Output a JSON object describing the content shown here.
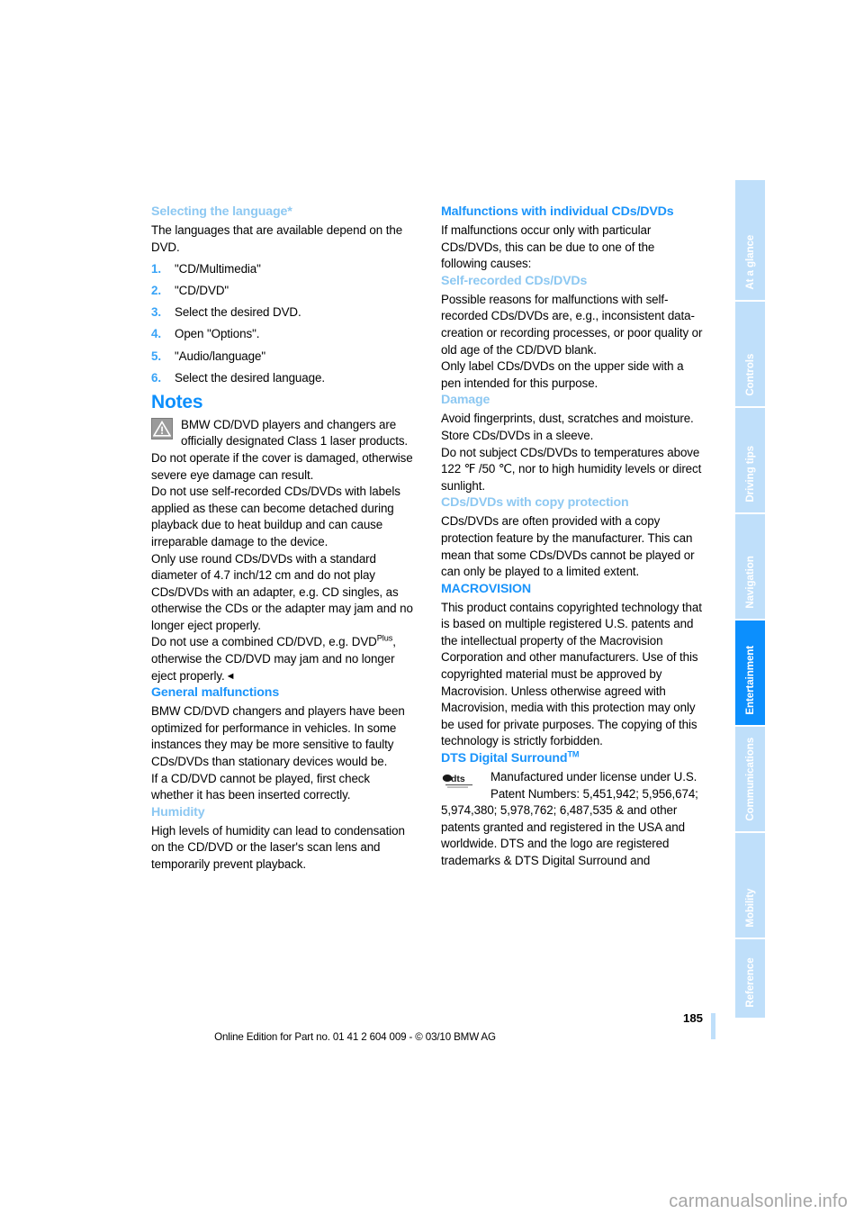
{
  "document": {
    "page_number": "185",
    "footer_text": "Online Edition for Part no. 01 41 2 604 009 - © 03/10 BMW AG",
    "watermark": "carmanualsonline.info",
    "accent_blue": "#0d8ffc",
    "light_blue": "#8dc8f2",
    "tab_blue": "#bfdffa"
  },
  "sidebar": {
    "tabs": [
      {
        "label": "At a glance",
        "active": false
      },
      {
        "label": "Controls",
        "active": false
      },
      {
        "label": "Driving tips",
        "active": false
      },
      {
        "label": "Navigation",
        "active": false
      },
      {
        "label": "Entertainment",
        "active": true
      },
      {
        "label": "Communications",
        "active": false
      },
      {
        "label": "Mobility",
        "active": false
      },
      {
        "label": "Reference",
        "active": false
      }
    ]
  },
  "left_column": {
    "selecting_language": {
      "heading": "Selecting the language*",
      "intro": "The languages that are available depend on the DVD.",
      "steps": [
        {
          "num": "1.",
          "text": "\"CD/Multimedia\""
        },
        {
          "num": "2.",
          "text": "\"CD/DVD\""
        },
        {
          "num": "3.",
          "text": "Select the desired DVD."
        },
        {
          "num": "4.",
          "text": "Open \"Options\"."
        },
        {
          "num": "5.",
          "text": "\"Audio/language\""
        },
        {
          "num": "6.",
          "text": "Select the desired language."
        }
      ]
    },
    "notes": {
      "heading": "Notes",
      "icon": "warning-triangle-icon",
      "para1": "BMW CD/DVD players and changers are officially designated Class 1 laser products. Do not operate if the cover is damaged, otherwise severe eye damage can result.",
      "para2": "Do not use self-recorded CDs/DVDs with labels applied as these can become detached during playback due to heat buildup and can cause irreparable damage to the device.",
      "para3": "Only use round CDs/DVDs with a standard diameter of 4.7 inch/12 cm and do not play CDs/DVDs with an adapter, e.g. CD singles, as otherwise the CDs or the adapter may jam and no longer eject properly.",
      "para4_pre": "Do not use a combined CD/DVD, e.g. DVD",
      "para4_sup": "Plus",
      "para4_post": ", otherwise the CD/DVD may jam and no longer eject properly.",
      "endmark": "◄"
    },
    "general_malfunctions": {
      "heading": "General malfunctions",
      "para1": "BMW CD/DVD changers and players have been optimized for performance in vehicles. In some instances they may be more sensitive to faulty CDs/DVDs than stationary devices would be.",
      "para2": "If a CD/DVD cannot be played, first check whether it has been inserted correctly."
    },
    "humidity": {
      "heading": "Humidity",
      "para1": "High levels of humidity can lead to condensation on the CD/DVD or the laser's scan lens and temporarily prevent playback."
    }
  },
  "right_column": {
    "malfunctions_individual": {
      "heading": "Malfunctions with individual CDs/DVDs",
      "para1": "If malfunctions occur only with particular CDs/DVDs, this can be due to one of the following causes:"
    },
    "self_recorded": {
      "heading": "Self-recorded CDs/DVDs",
      "para1": "Possible reasons for malfunctions with self-recorded CDs/DVDs are, e.g., inconsistent data-creation or recording processes, or poor quality or old age of the CD/DVD blank.",
      "para2": "Only label CDs/DVDs on the upper side with a pen intended for this purpose."
    },
    "damage": {
      "heading": "Damage",
      "para1": "Avoid fingerprints, dust, scratches and moisture.",
      "para2": "Store CDs/DVDs in a sleeve.",
      "para3": "Do not subject CDs/DVDs to temperatures above 122 ℉ /50 ℃, nor to high humidity levels or direct sunlight."
    },
    "copy_protection": {
      "heading": "CDs/DVDs with copy protection",
      "para1": "CDs/DVDs are often provided with a copy protection feature by the manufacturer. This can mean that some CDs/DVDs cannot be played or can only be played to a limited extent."
    },
    "macrovision": {
      "heading": "MACROVISION",
      "para1": "This product contains copyrighted technology that is based on multiple registered U.S. patents and the intellectual property of the Macrovision Corporation and other manufacturers. Use of this copyrighted material must be approved by Macrovision. Unless otherwise agreed with Macrovision, media with this protection may only be used for private purposes. The copying of this technology is strictly forbidden."
    },
    "dts": {
      "heading_main": "DTS Digital Surround",
      "heading_sup": "TM",
      "logo": "dts-logo",
      "logo_text": "dts",
      "para1": "Manufactured under license under U.S. Patent Numbers: 5,451,942; 5,956,674; 5,974,380; 5,978,762; 6,487,535 & and other patents granted and registered in the USA and worldwide. DTS and the logo are registered trademarks & DTS Digital Surround and"
    }
  }
}
